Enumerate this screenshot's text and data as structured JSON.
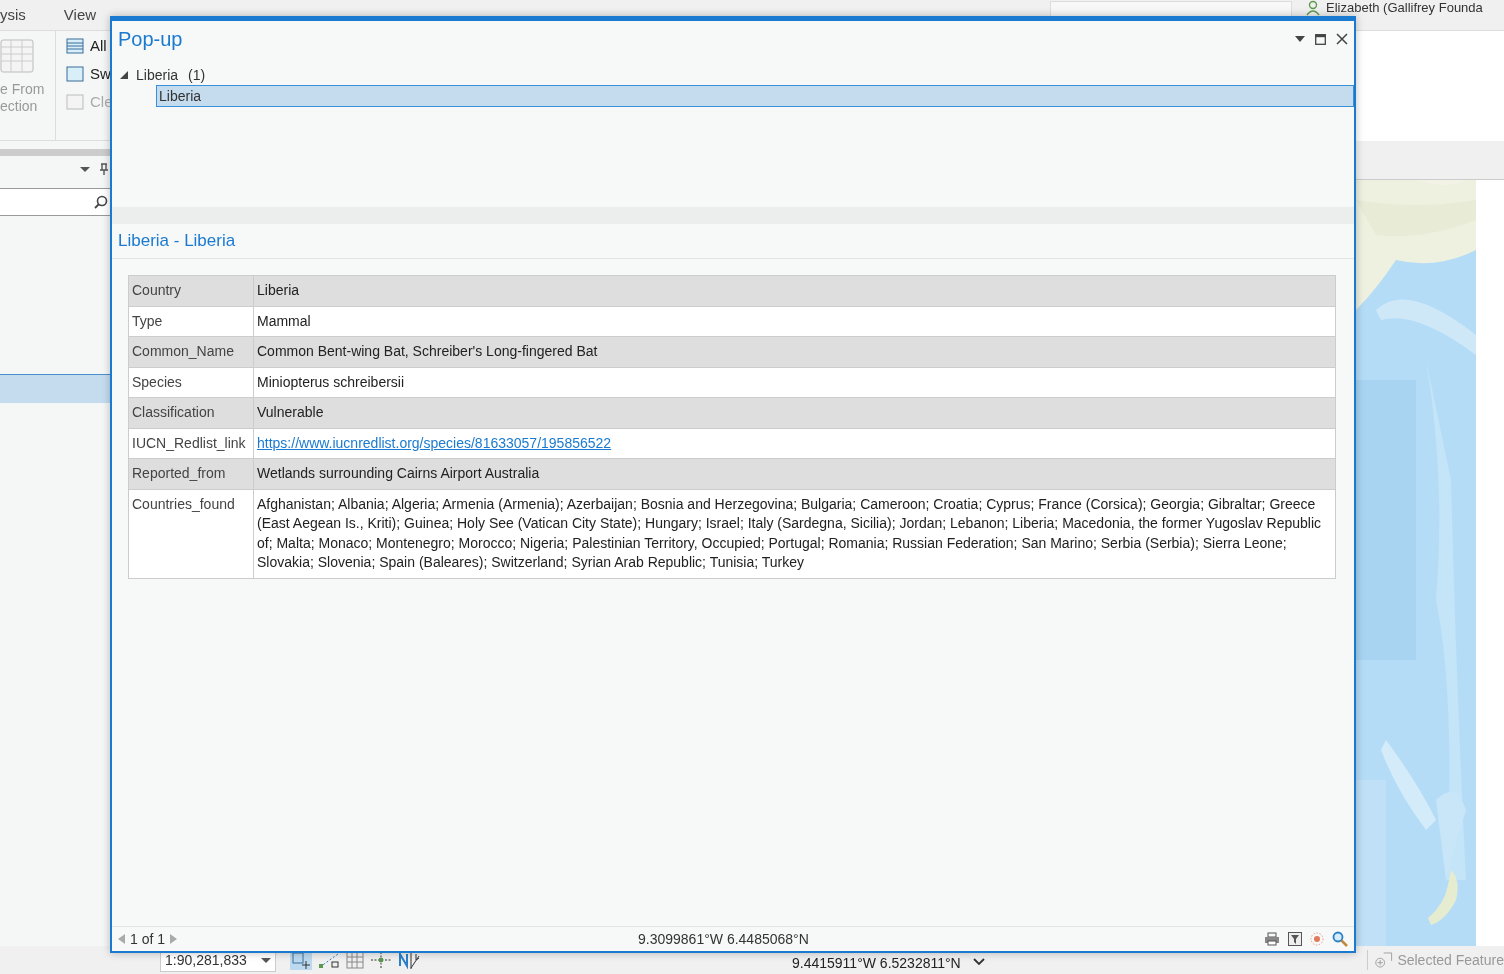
{
  "app": {
    "ribbon_tabs": [
      {
        "label": "ysis"
      },
      {
        "label": "View"
      }
    ],
    "ribbon_large_button": {
      "lines": [
        "e From",
        "ection"
      ]
    },
    "ribbon_small_buttons": [
      {
        "label": "All",
        "disabled": false
      },
      {
        "label": "Sw",
        "disabled": false
      },
      {
        "label": "Cle",
        "disabled": true
      }
    ],
    "user": "Elizabeth (Gallifrey Founda"
  },
  "popup": {
    "title": "Pop-up",
    "tree": [
      {
        "label": "Liberia",
        "count": "(1)",
        "expanded": true,
        "children": [
          {
            "label": "Liberia",
            "selected": true
          }
        ]
      }
    ],
    "feature_title": "Liberia - Liberia",
    "attributes": [
      {
        "field": "Country",
        "value": "Liberia",
        "kind": "text"
      },
      {
        "field": "Type",
        "value": "Mammal",
        "kind": "text"
      },
      {
        "field": "Common_Name",
        "value": "Common Bent-wing Bat, Schreiber's Long-fingered Bat",
        "kind": "text"
      },
      {
        "field": "Species",
        "value": "Miniopterus schreibersii",
        "kind": "text"
      },
      {
        "field": "Classification",
        "value": "Vulnerable",
        "kind": "text"
      },
      {
        "field": "IUCN_Redlist_link",
        "value": "https://www.iucnredlist.org/species/81633057/195856522",
        "kind": "link"
      },
      {
        "field": "Reported_from",
        "value": "Wetlands surrounding Cairns Airport Australia",
        "kind": "text"
      },
      {
        "field": "Countries_found",
        "value": "Afghanistan; Albania; Algeria; Armenia (Armenia); Azerbaijan; Bosnia and Herzegovina; Bulgaria; Cameroon; Croatia; Cyprus; France (Corsica); Georgia; Gibraltar; Greece (East Aegean Is., Kriti); Guinea; Holy See (Vatican City State); Hungary; Israel; Italy (Sardegna, Sicilia); Jordan; Lebanon; Liberia; Macedonia, the former Yugoslav Republic of; Malta; Monaco; Montenegro; Morocco; Nigeria; Palestinian Territory, Occupied; Portugal; Romania; Russian Federation; San Marino; Serbia (Serbia); Sierra Leone; Slovakia; Slovenia; Spain (Baleares); Switzerland; Syrian Arab Republic; Tunisia; Turkey",
        "kind": "text"
      }
    ],
    "record_nav": "1 of 1",
    "location": "9.3099861°W 6.4485068°N"
  },
  "status_bar": {
    "scale": "1:90,281,833",
    "coordinates": "9.4415911°W 6.5232811°N",
    "selected_features": "Selected Feature"
  }
}
